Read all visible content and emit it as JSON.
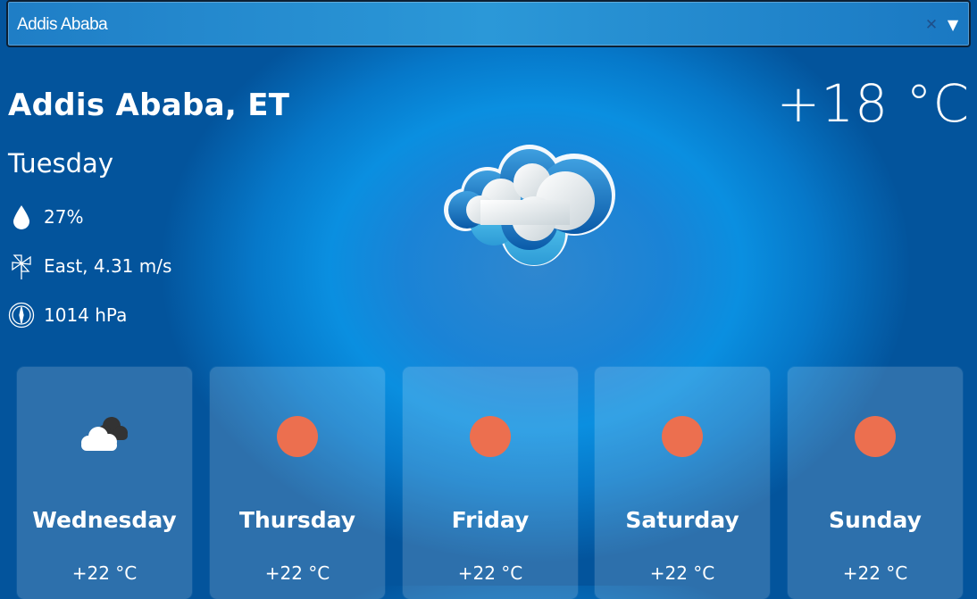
{
  "search": {
    "value": "Addis Ababa",
    "clear_icon": "close-icon",
    "dropdown_icon": "chevron-down-icon",
    "clear_glyph": "✕",
    "dropdown_glyph": "▼"
  },
  "current": {
    "city": "Addis Ababa, ET",
    "temperature": "+18 °C",
    "day": "Tuesday",
    "condition_icon": "cloud-icon",
    "humidity": "27%",
    "wind": "East, 4.31 m/s",
    "pressure": "1014 hPa"
  },
  "forecast": [
    {
      "day": "Wednesday",
      "temp": "+22 °C",
      "icon": "cloud-dark-icon"
    },
    {
      "day": "Thursday",
      "temp": "+22 °C",
      "icon": "sun-icon"
    },
    {
      "day": "Friday",
      "temp": "+22 °C",
      "icon": "sun-icon"
    },
    {
      "day": "Saturday",
      "temp": "+22 °C",
      "icon": "sun-icon"
    },
    {
      "day": "Sunday",
      "temp": "+22 °C",
      "icon": "sun-icon"
    }
  ],
  "colors": {
    "sun": "#ec6f4f",
    "background": "#0a8fe0"
  }
}
